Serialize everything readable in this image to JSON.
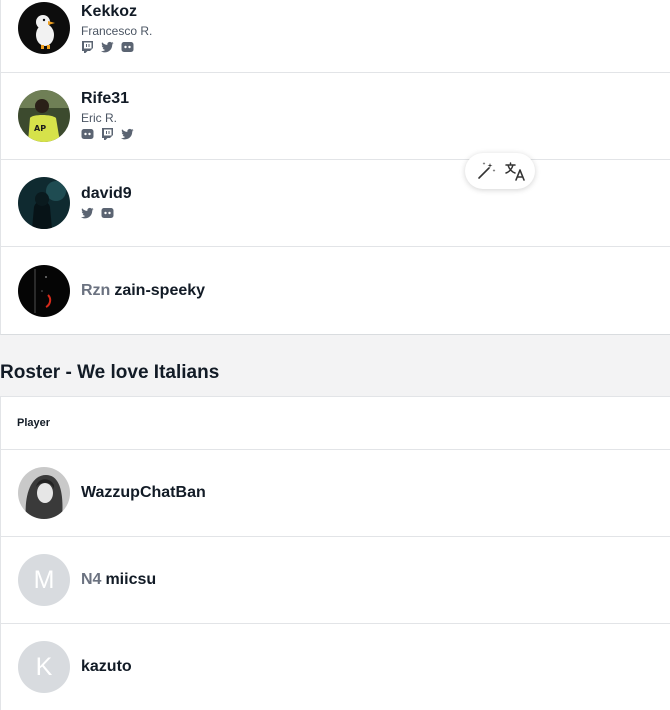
{
  "top_players": [
    {
      "name": "Kekkoz",
      "real_name": "Francesco R.",
      "socials": [
        "twitch-icon",
        "twitter-icon",
        "discord-icon"
      ],
      "avatar": "duck-avatar"
    },
    {
      "name": "Rife31",
      "real_name": "Eric R.",
      "socials": [
        "discord-icon",
        "twitch-icon",
        "twitter-icon"
      ],
      "avatar": "jersey-avatar"
    },
    {
      "name": "david9",
      "real_name": "",
      "socials": [
        "twitter-icon",
        "discord-icon"
      ],
      "avatar": "dark-avatar"
    },
    {
      "name": "zain-speeky",
      "tag": "Rzn",
      "avatar": "night-avatar"
    }
  ],
  "roster": {
    "title": "Roster - We love Italians",
    "column_header": "Player",
    "players": [
      {
        "name": "WazzupChatBan",
        "tag": "",
        "avatar": "photo"
      },
      {
        "name": "miicsu",
        "tag": "N4",
        "avatar_letter": "M"
      },
      {
        "name": "kazuto",
        "tag": "",
        "avatar_letter": "K"
      }
    ]
  },
  "floating_tools": [
    "magic-wand-icon",
    "translate-icon"
  ]
}
